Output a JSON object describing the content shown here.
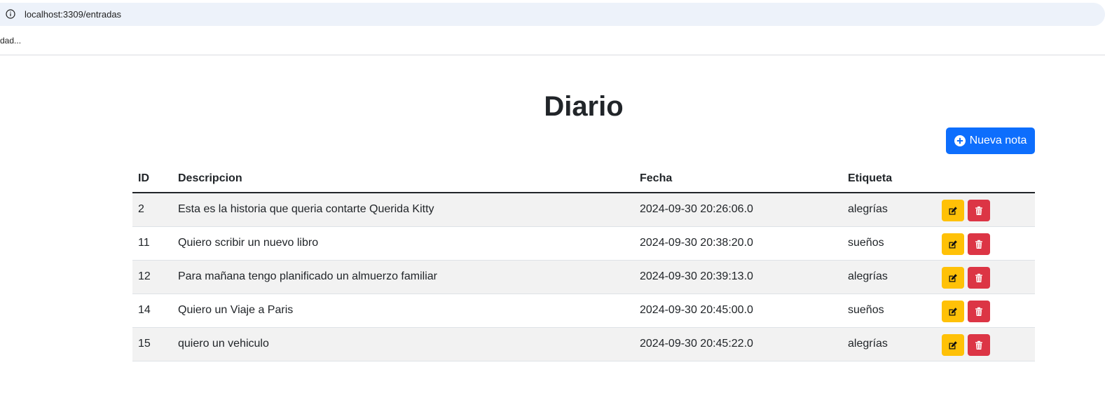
{
  "browser": {
    "url": "localhost:3309/entradas",
    "bookmark": "dad..."
  },
  "page": {
    "title": "Diario",
    "new_button_label": "Nueva nota"
  },
  "table": {
    "headers": {
      "id": "ID",
      "description": "Descripcion",
      "date": "Fecha",
      "tag": "Etiqueta"
    },
    "rows": [
      {
        "id": "2",
        "description": "Esta es la historia que queria contarte Querida Kitty",
        "date": "2024-09-30 20:26:06.0",
        "tag": "alegrías"
      },
      {
        "id": "11",
        "description": "Quiero scribir un nuevo libro",
        "date": "2024-09-30 20:38:20.0",
        "tag": "sueños"
      },
      {
        "id": "12",
        "description": "Para mañana tengo planificado un almuerzo familiar",
        "date": "2024-09-30 20:39:13.0",
        "tag": "alegrías"
      },
      {
        "id": "14",
        "description": "Quiero un Viaje a Paris",
        "date": "2024-09-30 20:45:00.0",
        "tag": "sueños"
      },
      {
        "id": "15",
        "description": "quiero un vehiculo",
        "date": "2024-09-30 20:45:22.0",
        "tag": "alegrías"
      }
    ]
  },
  "icons": {
    "info": "info-icon",
    "plus": "plus-circle-icon",
    "edit": "edit-icon",
    "delete": "trash-icon"
  },
  "colors": {
    "primary": "#0d6efd",
    "warning": "#ffc107",
    "danger": "#dc3545",
    "stripe": "#f2f2f2"
  }
}
